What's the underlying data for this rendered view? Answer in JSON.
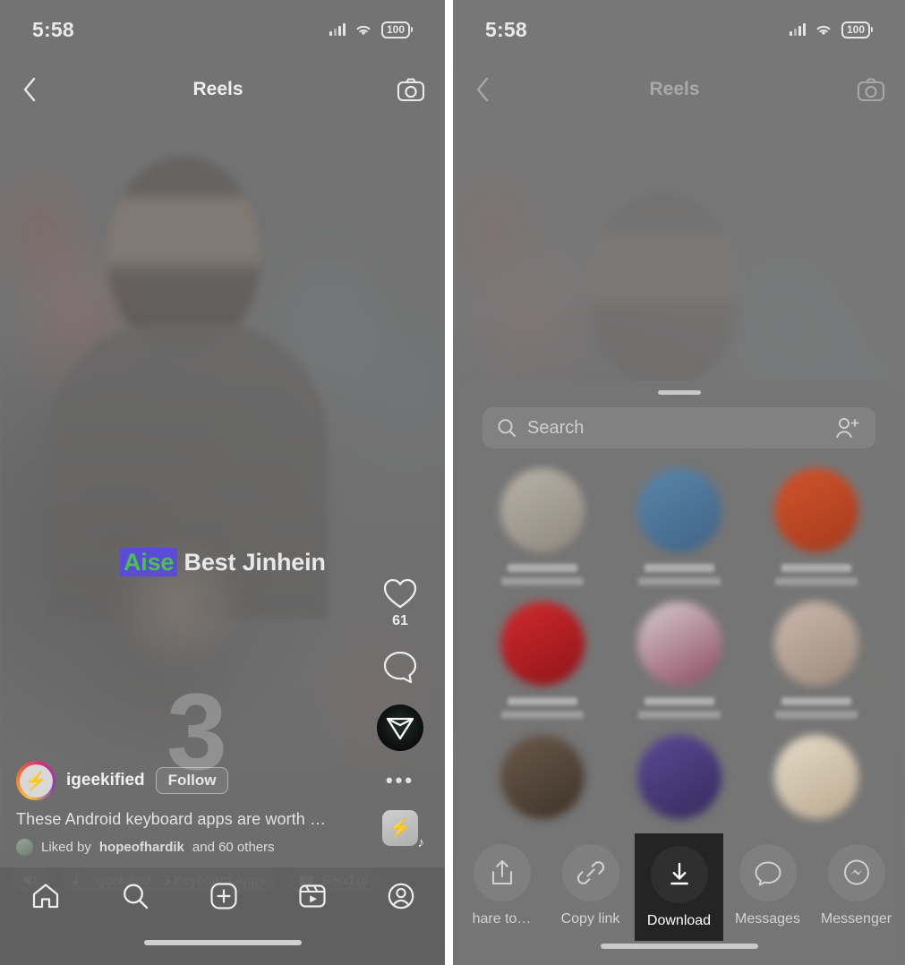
{
  "app": {
    "name": "Instagram Reels",
    "accent_dark": "#242424",
    "surface": "#6f6f6f"
  },
  "status_bar": {
    "time": "5:58",
    "battery_percent": "100",
    "signal_icon": "cellular-bars-icon",
    "wifi_icon": "wifi-icon",
    "battery_icon": "battery-icon"
  },
  "header": {
    "back_icon": "chevron-left-icon",
    "title": "Reels",
    "camera_icon": "camera-icon"
  },
  "reel": {
    "subtitle_highlight": "Aise",
    "subtitle_rest": "Best Jinhein",
    "subtitle_highlight_bg": "#5b4bd6",
    "subtitle_highlight_color": "#49c24a",
    "watermark": "3",
    "username": "igeekified",
    "follow_label": "Follow",
    "caption": "These Android keyboard apps are worth …",
    "liked_by": "Liked by",
    "liked_user": "hopeofhardik",
    "liked_rest": "and 60 others",
    "avatar_icon": "profile-avatar-igeekified",
    "avatar_glyph": "⚡"
  },
  "actions_rail": {
    "like_icon": "heart-icon",
    "like_count": "61",
    "comment_icon": "comment-bubble-icon",
    "share_icon": "share-paper-plane-icon",
    "more_icon": "more-options-icon",
    "audio_icon": "audio-track-thumbnail-icon",
    "audio_glyph": "⚡",
    "note_glyph": "♪"
  },
  "pill_row": {
    "volume_icon": "volume-on-icon",
    "music_icon": "music-note-icon",
    "music_text": "igeekified · 3 Keyboard Apps",
    "gift_icon": "gift-icon",
    "gift_label": "Send gi"
  },
  "tab_bar": {
    "items": [
      {
        "name": "home",
        "icon": "home-icon"
      },
      {
        "name": "search",
        "icon": "search-icon"
      },
      {
        "name": "create",
        "icon": "plus-square-icon"
      },
      {
        "name": "reels",
        "icon": "reels-icon"
      },
      {
        "name": "profile",
        "icon": "profile-icon"
      }
    ]
  },
  "share_sheet": {
    "grabber_icon": "drag-handle-icon",
    "search": {
      "icon": "search-icon",
      "placeholder": "Search",
      "value": "",
      "add_people_icon": "add-people-icon"
    },
    "contacts": [
      {
        "name": "contact-1",
        "color_a": "#b9b2a8",
        "color_b": "#8f887f"
      },
      {
        "name": "contact-2",
        "color_a": "#5b86ac",
        "color_b": "#3f6384"
      },
      {
        "name": "contact-3",
        "color_a": "#d4542c",
        "color_b": "#a33a1c"
      },
      {
        "name": "contact-4",
        "color_a": "#d22a2f",
        "color_b": "#8e1418"
      },
      {
        "name": "contact-5",
        "color_a": "#c9b5bf",
        "color_b": "#8e4a62"
      },
      {
        "name": "contact-6",
        "color_a": "#cbb9ad",
        "color_b": "#9d8a7d"
      },
      {
        "name": "contact-7",
        "color_a": "#6b5a4c",
        "color_b": "#3d3228"
      },
      {
        "name": "contact-8",
        "color_a": "#5b4a96",
        "color_b": "#342a5c"
      },
      {
        "name": "contact-9",
        "color_a": "#e6dcc9",
        "color_b": "#b9a88f"
      }
    ],
    "actions": [
      {
        "name": "share-to",
        "icon": "share-upload-icon",
        "label": "hare to…",
        "highlighted": false
      },
      {
        "name": "copy-link",
        "icon": "link-icon",
        "label": "Copy link",
        "highlighted": false
      },
      {
        "name": "download",
        "icon": "download-icon",
        "label": "Download",
        "highlighted": true
      },
      {
        "name": "messages",
        "icon": "messages-bubble-icon",
        "label": "Messages",
        "highlighted": false
      },
      {
        "name": "messenger",
        "icon": "messenger-icon",
        "label": "Messenger",
        "highlighted": false
      }
    ]
  }
}
